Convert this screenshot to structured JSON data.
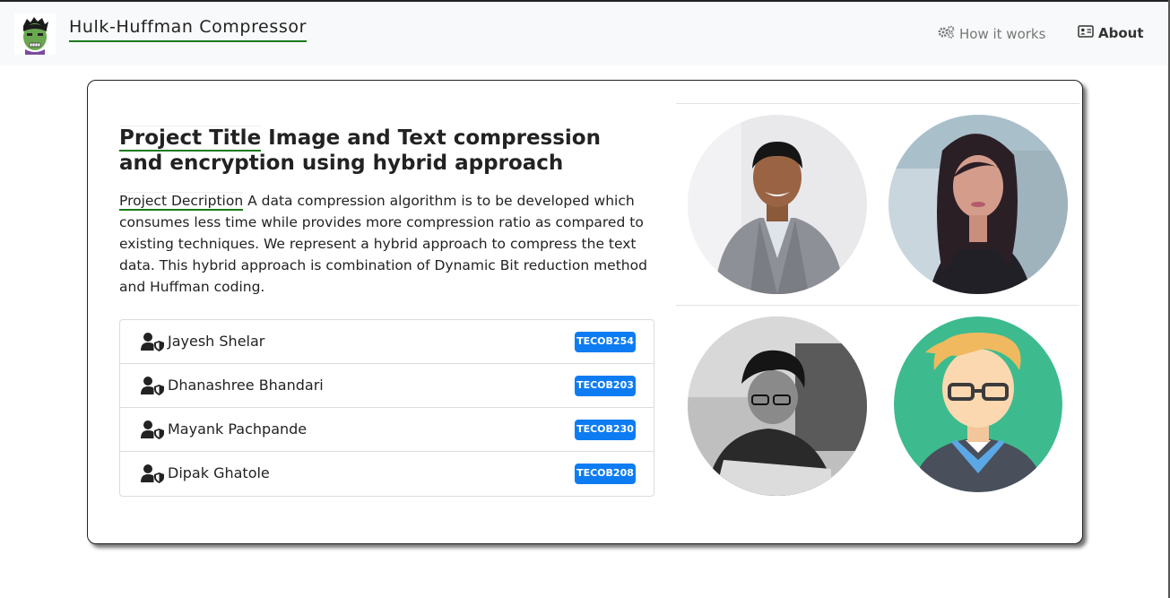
{
  "navbar": {
    "brand": "Hulk-Huffman Compressor",
    "links": [
      {
        "label": "How it works",
        "icon": "gears-icon"
      },
      {
        "label": "About",
        "icon": "id-card-icon"
      }
    ]
  },
  "project": {
    "title_label": "Project Title",
    "title_text": " Image and Text compression and encryption using hybrid approach",
    "desc_label": "Project Decription",
    "desc_text": " A data compression algorithm is to be developed which consumes less time while provides more compression ratio as compared to existing techniques. We represent a hybrid approach to compress the text data. This hybrid approach is combination of Dynamic Bit reduction method and Huffman coding."
  },
  "members": [
    {
      "name": "Jayesh Shelar",
      "roll": "TECOB254"
    },
    {
      "name": "Dhanashree Bhandari",
      "roll": "TECOB203"
    },
    {
      "name": "Mayank Pachpande",
      "roll": "TECOB230"
    },
    {
      "name": "Dipak Ghatole",
      "roll": "TECOB208"
    }
  ],
  "colors": {
    "badge": "#0d7cf2",
    "underline": "#1a7a1a",
    "navbar_bg": "#f8f9fa"
  }
}
